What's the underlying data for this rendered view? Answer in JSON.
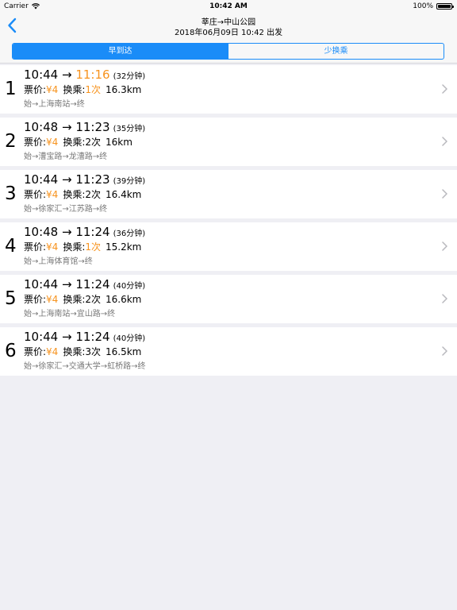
{
  "status": {
    "carrier": "Carrier",
    "time": "10:42 AM",
    "battery": "100%"
  },
  "nav": {
    "title": "莘庄→中山公园",
    "subtitle": "2018年06月09日 10:42 出发"
  },
  "segments": [
    {
      "label": "早到达",
      "active": true
    },
    {
      "label": "少换乘",
      "active": false
    }
  ],
  "labels": {
    "price": "票价:",
    "transfer": "换乘:"
  },
  "routes": [
    {
      "index": "1",
      "depart": "10:44",
      "arrow": " → ",
      "arrive": "11:16",
      "arrive_highlight": true,
      "duration": "(32分钟)",
      "price": "¥4",
      "transfers": "1次",
      "transfers_highlight": true,
      "distance": "16.3km",
      "path": "始→上海南站→终"
    },
    {
      "index": "2",
      "depart": "10:48",
      "arrow": " → ",
      "arrive": "11:23",
      "arrive_highlight": false,
      "duration": "(35分钟)",
      "price": "¥4",
      "transfers": "2次",
      "transfers_highlight": false,
      "distance": "16km",
      "path": "始→漕宝路→龙漕路→终"
    },
    {
      "index": "3",
      "depart": "10:44",
      "arrow": " → ",
      "arrive": "11:23",
      "arrive_highlight": false,
      "duration": "(39分钟)",
      "price": "¥4",
      "transfers": "2次",
      "transfers_highlight": false,
      "distance": "16.4km",
      "path": "始→徐家汇→江苏路→终"
    },
    {
      "index": "4",
      "depart": "10:48",
      "arrow": " → ",
      "arrive": "11:24",
      "arrive_highlight": false,
      "duration": "(36分钟)",
      "price": "¥4",
      "transfers": "1次",
      "transfers_highlight": true,
      "distance": "15.2km",
      "path": "始→上海体育馆→终"
    },
    {
      "index": "5",
      "depart": "10:44",
      "arrow": " → ",
      "arrive": "11:24",
      "arrive_highlight": false,
      "duration": "(40分钟)",
      "price": "¥4",
      "transfers": "2次",
      "transfers_highlight": false,
      "distance": "16.6km",
      "path": "始→上海南站→宜山路→终"
    },
    {
      "index": "6",
      "depart": "10:44",
      "arrow": " → ",
      "arrive": "11:24",
      "arrive_highlight": false,
      "duration": "(40分钟)",
      "price": "¥4",
      "transfers": "3次",
      "transfers_highlight": false,
      "distance": "16.5km",
      "path": "始→徐家汇→交通大学→虹桥路→终"
    }
  ],
  "colors": {
    "accent": "#1a8cf8",
    "highlight": "#f7931e",
    "background": "#efeff4"
  }
}
